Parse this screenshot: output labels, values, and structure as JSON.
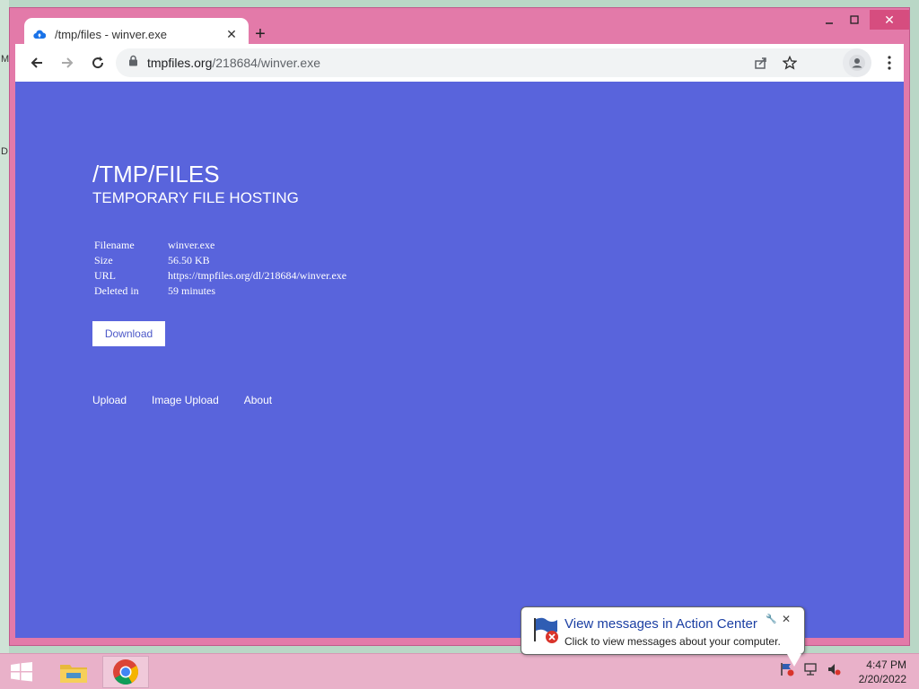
{
  "desktop": {
    "glyph_top": "M",
    "glyph_bottom": "D"
  },
  "browser": {
    "tab_title": "/tmp/files - winver.exe",
    "new_tab_label": "+",
    "url_host": "tmpfiles.org",
    "url_path": "/218684/winver.exe"
  },
  "page": {
    "title": "/TMP/FILES",
    "subtitle": "TEMPORARY FILE HOSTING",
    "info": [
      {
        "key": "Filename",
        "value": "winver.exe"
      },
      {
        "key": "Size",
        "value": "56.50 KB"
      },
      {
        "key": "URL",
        "value": "https://tmpfiles.org/dl/218684/winver.exe"
      },
      {
        "key": "Deleted in",
        "value": "59 minutes"
      }
    ],
    "download_label": "Download",
    "links": [
      "Upload",
      "Image Upload",
      "About"
    ]
  },
  "notification": {
    "title": "View messages in Action Center",
    "body": "Click to view messages about your computer."
  },
  "taskbar": {
    "time": "4:47 PM",
    "date": "2/20/2022"
  },
  "colors": {
    "page_bg": "#5964dc",
    "window_frame": "#e37aa9",
    "taskbar": "#e9b1c9"
  }
}
